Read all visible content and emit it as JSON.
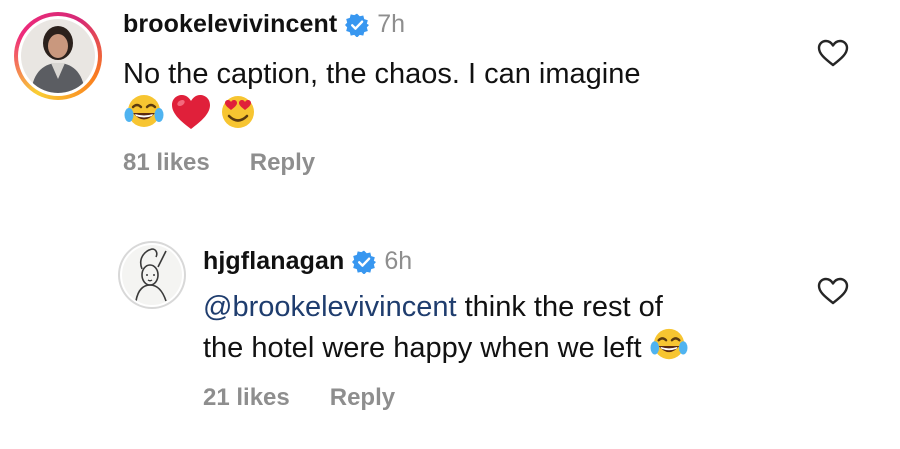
{
  "comments": [
    {
      "username": "brookelevivincent",
      "verified": true,
      "time": "7h",
      "text": "No the caption, the chaos. I can imagine",
      "emojis": [
        "face-with-tears-of-joy",
        "red-heart",
        "smiling-face-with-heart-eyes"
      ],
      "likes": "81 likes",
      "reply_label": "Reply",
      "avatar": "profile-photo-woman-in-grey-blazer"
    },
    {
      "username": "hjgflanagan",
      "verified": true,
      "time": "6h",
      "mention": "@brookelevivincent",
      "text_line1": " think the rest of",
      "text_line2": "the hotel were happy when we left",
      "emojis": [
        "face-with-tears-of-joy"
      ],
      "likes": "21 likes",
      "reply_label": "Reply",
      "avatar": "profile-photo-sketch-figure"
    }
  ],
  "colors": {
    "verified_blue": "#3897f0",
    "secondary_text": "#8e8e8e",
    "mention": "#1f3d6e",
    "heart_red": "#e0203a"
  }
}
